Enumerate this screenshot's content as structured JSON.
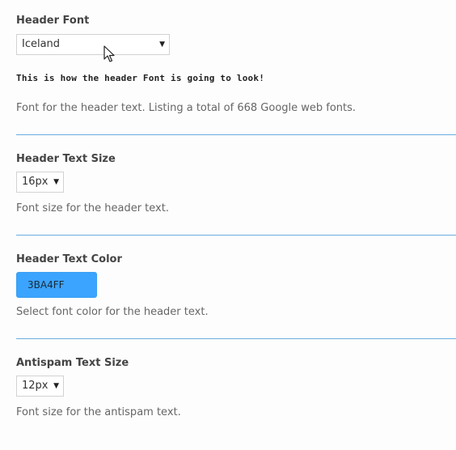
{
  "header_font": {
    "label": "Header Font",
    "selected": "Iceland",
    "preview_text": "This is how the header Font is going to look!",
    "description": "Font for the header text. Listing a total of 668 Google web fonts."
  },
  "header_text_size": {
    "label": "Header Text Size",
    "selected": "16px",
    "description": "Font size for the header text."
  },
  "header_text_color": {
    "label": "Header Text Color",
    "value": "3BA4FF",
    "swatch_color": "#3BA4FF",
    "description": "Select font color for the header text."
  },
  "antispam_text_size": {
    "label": "Antispam Text Size",
    "selected": "12px",
    "description": "Font size for the antispam text."
  },
  "icons": {
    "dropdown_caret": "▼",
    "cursor": "mouse-pointer-icon"
  }
}
